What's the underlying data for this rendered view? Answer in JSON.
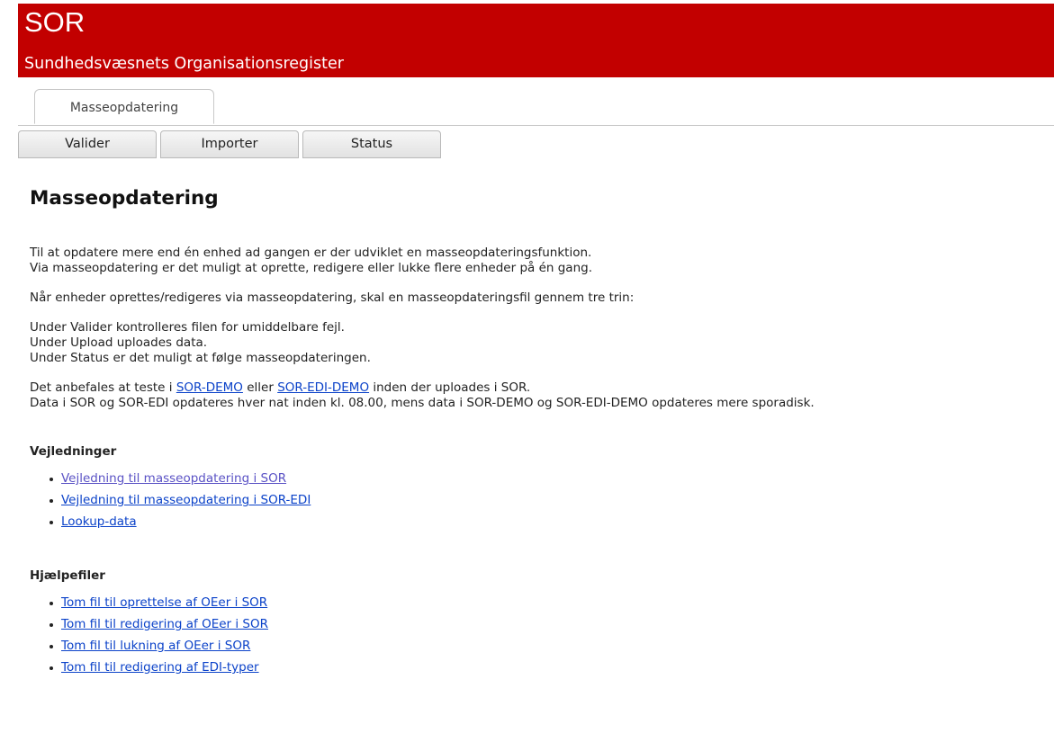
{
  "header": {
    "title": "SOR",
    "subtitle": "Sundhedsvæsnets Organisationsregister"
  },
  "tabs": [
    {
      "label": "Masseopdatering"
    }
  ],
  "subnav": [
    {
      "label": "Valider"
    },
    {
      "label": "Importer"
    },
    {
      "label": "Status"
    }
  ],
  "main": {
    "heading": "Masseopdatering",
    "intro_line1": "Til at opdatere mere end én enhed ad gangen er der udviklet en masseopdateringsfunktion.",
    "intro_line2": "Via masseopdatering er det muligt at oprette, redigere eller lukke flere enheder på én gang.",
    "steps_intro": "Når enheder oprettes/redigeres via masseopdatering, skal en masseopdateringsfil gennem tre trin:",
    "step1": "Under Valider kontrolleres filen for umiddelbare fejl.",
    "step2": "Under Upload uploades data.",
    "step3": "Under Status er det muligt at følge masseopdateringen.",
    "demo_pre": "Det anbefales at teste i ",
    "demo_link1": "SOR-DEMO",
    "demo_mid": " eller ",
    "demo_link2": "SOR-EDI-DEMO",
    "demo_post": " inden der uploades i SOR.",
    "demo_note": "Data i SOR og SOR-EDI opdateres hver nat inden kl. 08.00, mens data i SOR-DEMO og SOR-EDI-DEMO opdateres mere sporadisk."
  },
  "guides": {
    "heading": "Vejledninger",
    "items": [
      "Vejledning til masseopdatering i SOR",
      "Vejledning til masseopdatering i SOR-EDI",
      "Lookup-data"
    ]
  },
  "helpfiles": {
    "heading": "Hjælpefiler",
    "items": [
      "Tom fil til oprettelse af OEer i SOR",
      "Tom fil til redigering af OEer i SOR",
      "Tom fil til lukning af OEer i SOR",
      "Tom fil til redigering af EDI-typer"
    ]
  },
  "colors": {
    "header_bg": "#c20000",
    "link": "#0b42c9",
    "visited_link": "#5a52c5"
  }
}
